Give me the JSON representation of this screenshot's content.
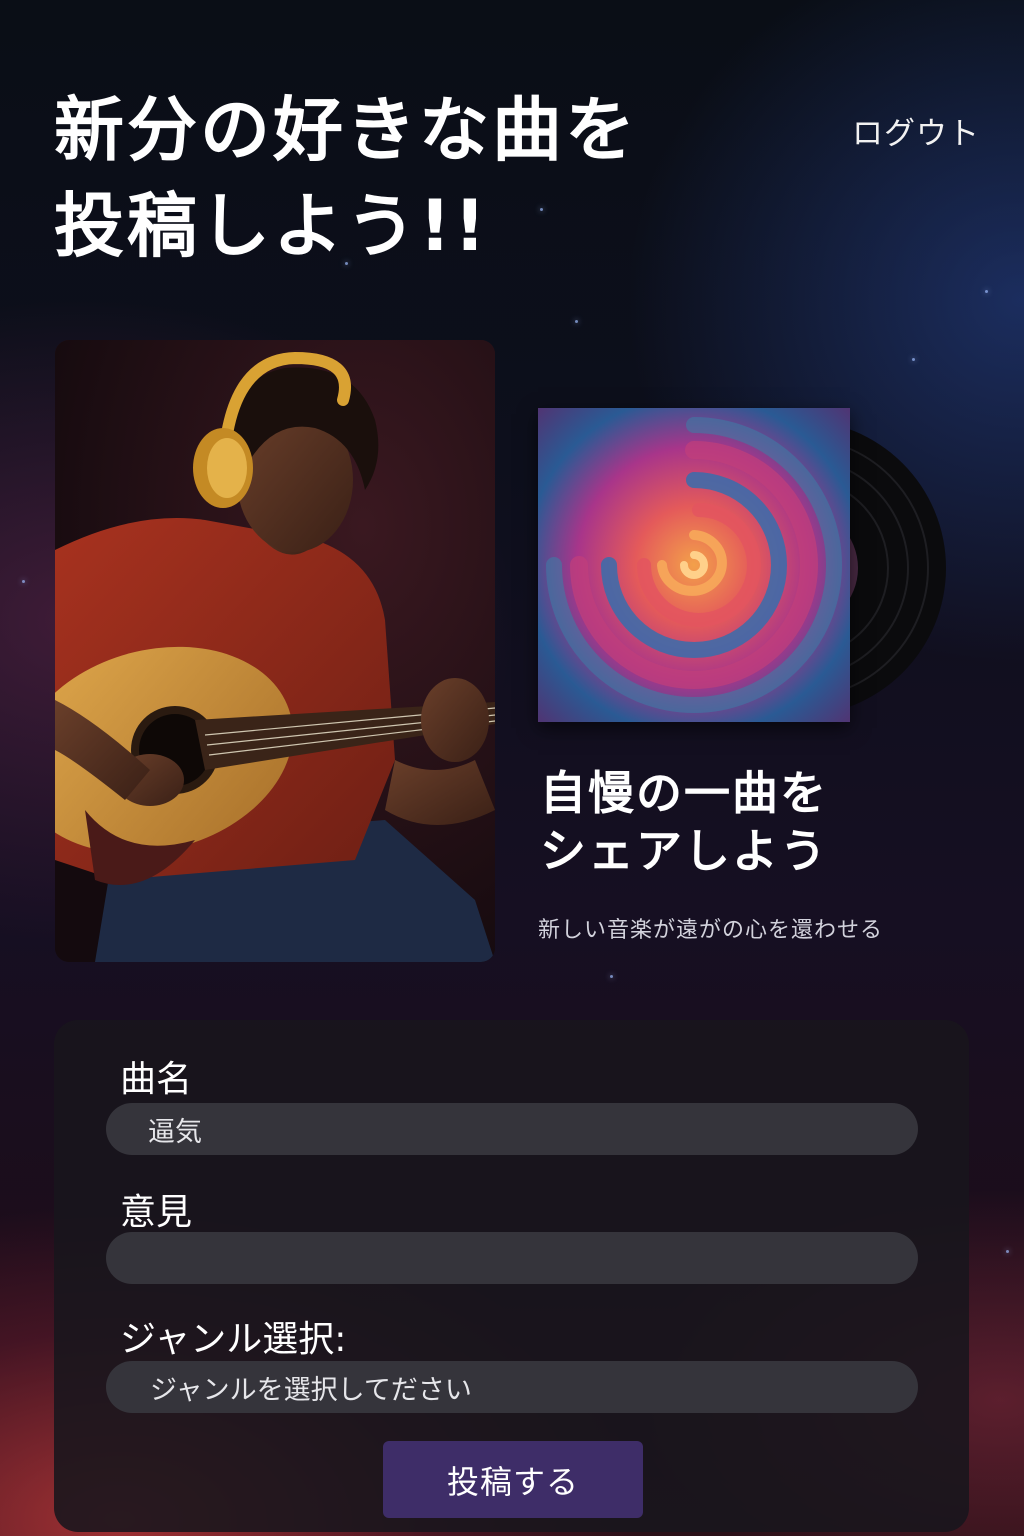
{
  "header": {
    "title_line1": "新分の好きな曲を",
    "title_line2": "投稿しよう!!",
    "logout_label": "ログウト"
  },
  "promo": {
    "title_line1": "自慢の一曲を",
    "title_line2": "シェアしよう",
    "subtitle": "新しい音楽が遠がの心を還わせる"
  },
  "form": {
    "song_label": "曲名",
    "song_value": "逼気",
    "opinion_label": "意見",
    "opinion_value": "",
    "genre_label": "ジャンル選択:",
    "genre_placeholder": "ジャンルを選択してださい",
    "submit_label": "投稿する"
  },
  "colors": {
    "accent": "#3e2d68",
    "panel": "#18161c",
    "field": "#35343b"
  }
}
